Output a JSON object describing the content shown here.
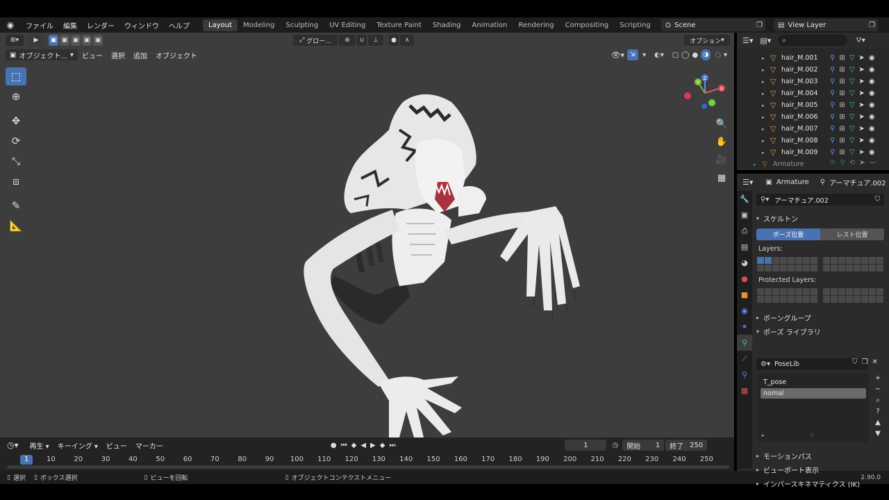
{
  "topbar": {
    "menu": [
      "ファイル",
      "編集",
      "レンダー",
      "ウィンドウ",
      "ヘルプ"
    ],
    "workspaces": [
      "Layout",
      "Modeling",
      "Sculpting",
      "UV Editing",
      "Texture Paint",
      "Shading",
      "Animation",
      "Rendering",
      "Compositing",
      "Scripting"
    ],
    "active_workspace": "Layout",
    "scene": "Scene",
    "view_layer": "View Layer"
  },
  "viewport": {
    "transform_orientation": "グロー...",
    "options_label": "オプション",
    "mode": "オブジェクト...",
    "menu": [
      "ビュー",
      "選択",
      "追加",
      "オブジェクト"
    ],
    "tools": [
      "select-box",
      "cursor",
      "move",
      "rotate",
      "scale",
      "transform",
      "annotate",
      "measure"
    ],
    "gizmo": {
      "z": "Z",
      "y": "Y",
      "x": "X"
    },
    "background_color": "#3d3d3d"
  },
  "outliner": {
    "items": [
      "hair_M.001",
      "hair_M.002",
      "hair_M.003",
      "hair_M.004",
      "hair_M.005",
      "hair_M.006",
      "hair_M.007",
      "hair_M.008",
      "hair_M.009"
    ],
    "armature_item": "Armature"
  },
  "properties": {
    "object_name": "Armature",
    "data_name": "アーマチュア.002",
    "datablock": "アーマチュア.002",
    "skeleton_section": "スケルトン",
    "pose_position": "ポーズ位置",
    "rest_position": "レスト位置",
    "layers_label": "Layers:",
    "protected_layers_label": "Protected Layers:",
    "bone_groups": "ボーングループ",
    "pose_library": "ポーズ ライブラリ",
    "poselib_name": "PoseLib",
    "poses": [
      "T_pose",
      "nomal"
    ],
    "selected_pose": "nomal",
    "motion_paths": "モーションパス",
    "viewport_display": "ビューポート表示",
    "inverse_kinematics": "インバースキネマティクス (IK)"
  },
  "timeline": {
    "menu": [
      "再生",
      "キーイング",
      "ビュー",
      "マーカー"
    ],
    "current_frame": "1",
    "start_label": "開始",
    "start": "1",
    "end_label": "終了",
    "end": "250",
    "ruler": [
      "10",
      "20",
      "30",
      "40",
      "50",
      "60",
      "70",
      "80",
      "90",
      "100",
      "110",
      "120",
      "130",
      "140",
      "150",
      "160",
      "170",
      "180",
      "190",
      "200",
      "210",
      "220",
      "230",
      "240",
      "250"
    ],
    "ruler_current": "1"
  },
  "statusbar": {
    "select": "選択",
    "box_select": "ボックス選択",
    "rotate_view": "ビューを回転",
    "context_menu": "オブジェクトコンテクストメニュー",
    "version": "2.90.0"
  },
  "colors": {
    "accent": "#4772b3",
    "mesh": "#e8e8e8",
    "mouth": "#b03a44"
  }
}
